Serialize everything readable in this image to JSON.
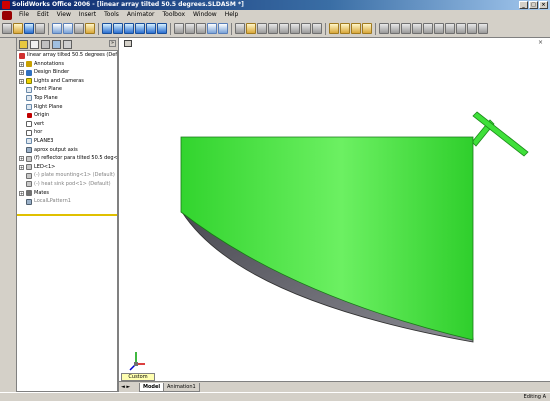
{
  "window": {
    "title": "SolidWorks Office 2006 - [linear array tilted 50.5 degrees.SLDASM *]",
    "buttons": {
      "minimize": "_",
      "maximize": "□",
      "close": "×"
    }
  },
  "menubar": {
    "items": [
      "File",
      "Edit",
      "View",
      "Insert",
      "Tools",
      "Animator",
      "Toolbox",
      "Window",
      "Help"
    ]
  },
  "feature_tree": {
    "items": [
      {
        "label": "linear array tilted 50.5 degrees (Defa",
        "icon": "assembly-icon",
        "expander": ""
      },
      {
        "label": "Annotations",
        "icon": "annotations-icon",
        "expander": "+"
      },
      {
        "label": "Design Binder",
        "icon": "design-binder-icon",
        "expander": "+"
      },
      {
        "label": "Lights and Cameras",
        "icon": "lights-icon",
        "expander": "+"
      },
      {
        "label": "Front Plane",
        "icon": "plane-icon",
        "expander": ""
      },
      {
        "label": "Top Plane",
        "icon": "plane-icon",
        "expander": ""
      },
      {
        "label": "Right Plane",
        "icon": "plane-icon",
        "expander": ""
      },
      {
        "label": "Origin",
        "icon": "origin-icon",
        "expander": ""
      },
      {
        "label": "vert",
        "icon": "sketch-icon",
        "expander": ""
      },
      {
        "label": "hor",
        "icon": "sketch-icon",
        "expander": ""
      },
      {
        "label": "PLANE3",
        "icon": "plane-icon",
        "expander": ""
      },
      {
        "label": "aprox output axis",
        "icon": "axis-icon",
        "expander": ""
      },
      {
        "label": "(f) reflector para tilted 50.5 deg<",
        "icon": "part-icon",
        "expander": "+"
      },
      {
        "label": "LED<1>",
        "icon": "part-icon",
        "expander": "+"
      },
      {
        "label": "(-) plate mounting<1> (Default)",
        "icon": "part-icon",
        "expander": "",
        "greyed": true
      },
      {
        "label": "(-) heat sink pod<1> (Default)",
        "icon": "part-icon",
        "expander": "",
        "greyed": true
      },
      {
        "label": "Mates",
        "icon": "mates-icon",
        "expander": "+"
      },
      {
        "label": "LocalLPattern1",
        "icon": "pattern-icon",
        "expander": "",
        "greyed": true
      }
    ]
  },
  "viewport": {
    "orientation_button": "Custom",
    "tabs": {
      "model": "Model",
      "animation": "Animation1"
    }
  },
  "statusbar": {
    "text": "Editing A"
  },
  "colors": {
    "model_green": "#3fe03a",
    "model_shadow": "#6a6a72",
    "titlebar": "#0a246a",
    "chrome": "#d4d0c8"
  }
}
